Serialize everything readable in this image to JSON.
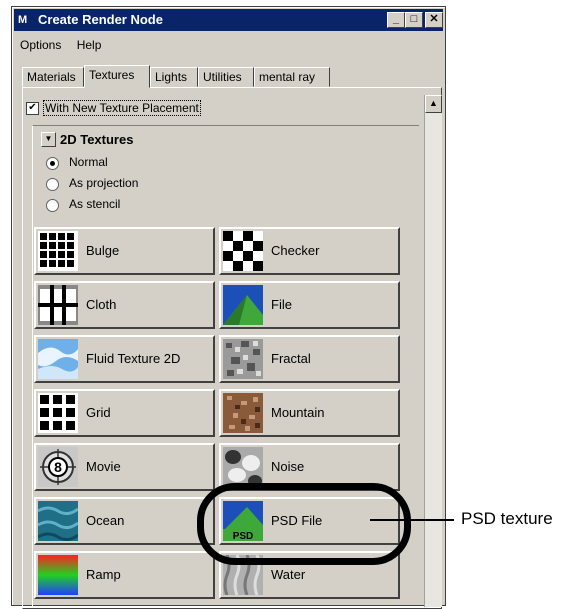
{
  "window": {
    "app_icon": "maya-icon",
    "title": "Create Render Node",
    "controls": {
      "minimize": "_",
      "maximize": "□",
      "close": "✕"
    }
  },
  "menubar": {
    "items": [
      "Options",
      "Help"
    ]
  },
  "tabs": [
    {
      "label": "Materials",
      "active": false
    },
    {
      "label": "Textures",
      "active": true
    },
    {
      "label": "Lights",
      "active": false
    },
    {
      "label": "Utilities",
      "active": false
    },
    {
      "label": "mental ray",
      "active": false
    }
  ],
  "placement_checkbox": {
    "label": "With New Texture Placement",
    "checked": true
  },
  "section": {
    "title": "2D Textures",
    "collapse_icon": "triangle-down-icon"
  },
  "radios": [
    {
      "label": "Normal",
      "selected": true
    },
    {
      "label": "As projection",
      "selected": false
    },
    {
      "label": "As stencil",
      "selected": false
    }
  ],
  "textures": [
    {
      "label": "Bulge",
      "icon": "bulge-icon"
    },
    {
      "label": "Checker",
      "icon": "checker-icon"
    },
    {
      "label": "Cloth",
      "icon": "cloth-icon"
    },
    {
      "label": "File",
      "icon": "file-icon"
    },
    {
      "label": "Fluid Texture 2D",
      "icon": "fluid-texture-icon"
    },
    {
      "label": "Fractal",
      "icon": "fractal-icon"
    },
    {
      "label": "Grid",
      "icon": "grid-icon"
    },
    {
      "label": "Mountain",
      "icon": "mountain-icon"
    },
    {
      "label": "Movie",
      "icon": "movie-icon"
    },
    {
      "label": "Noise",
      "icon": "noise-icon"
    },
    {
      "label": "Ocean",
      "icon": "ocean-icon"
    },
    {
      "label": "PSD File",
      "icon": "psd-file-icon",
      "icon_text": "PSD"
    },
    {
      "label": "Ramp",
      "icon": "ramp-icon"
    },
    {
      "label": "Water",
      "icon": "water-icon"
    }
  ],
  "callout": {
    "label": "PSD texture"
  },
  "colors": {
    "titlebar": "#0a246a",
    "window_bg": "#d4d0c8",
    "ocean": "#1f6f86",
    "ramp_top": "#ff2020",
    "ramp_bottom": "#1f3fff"
  }
}
